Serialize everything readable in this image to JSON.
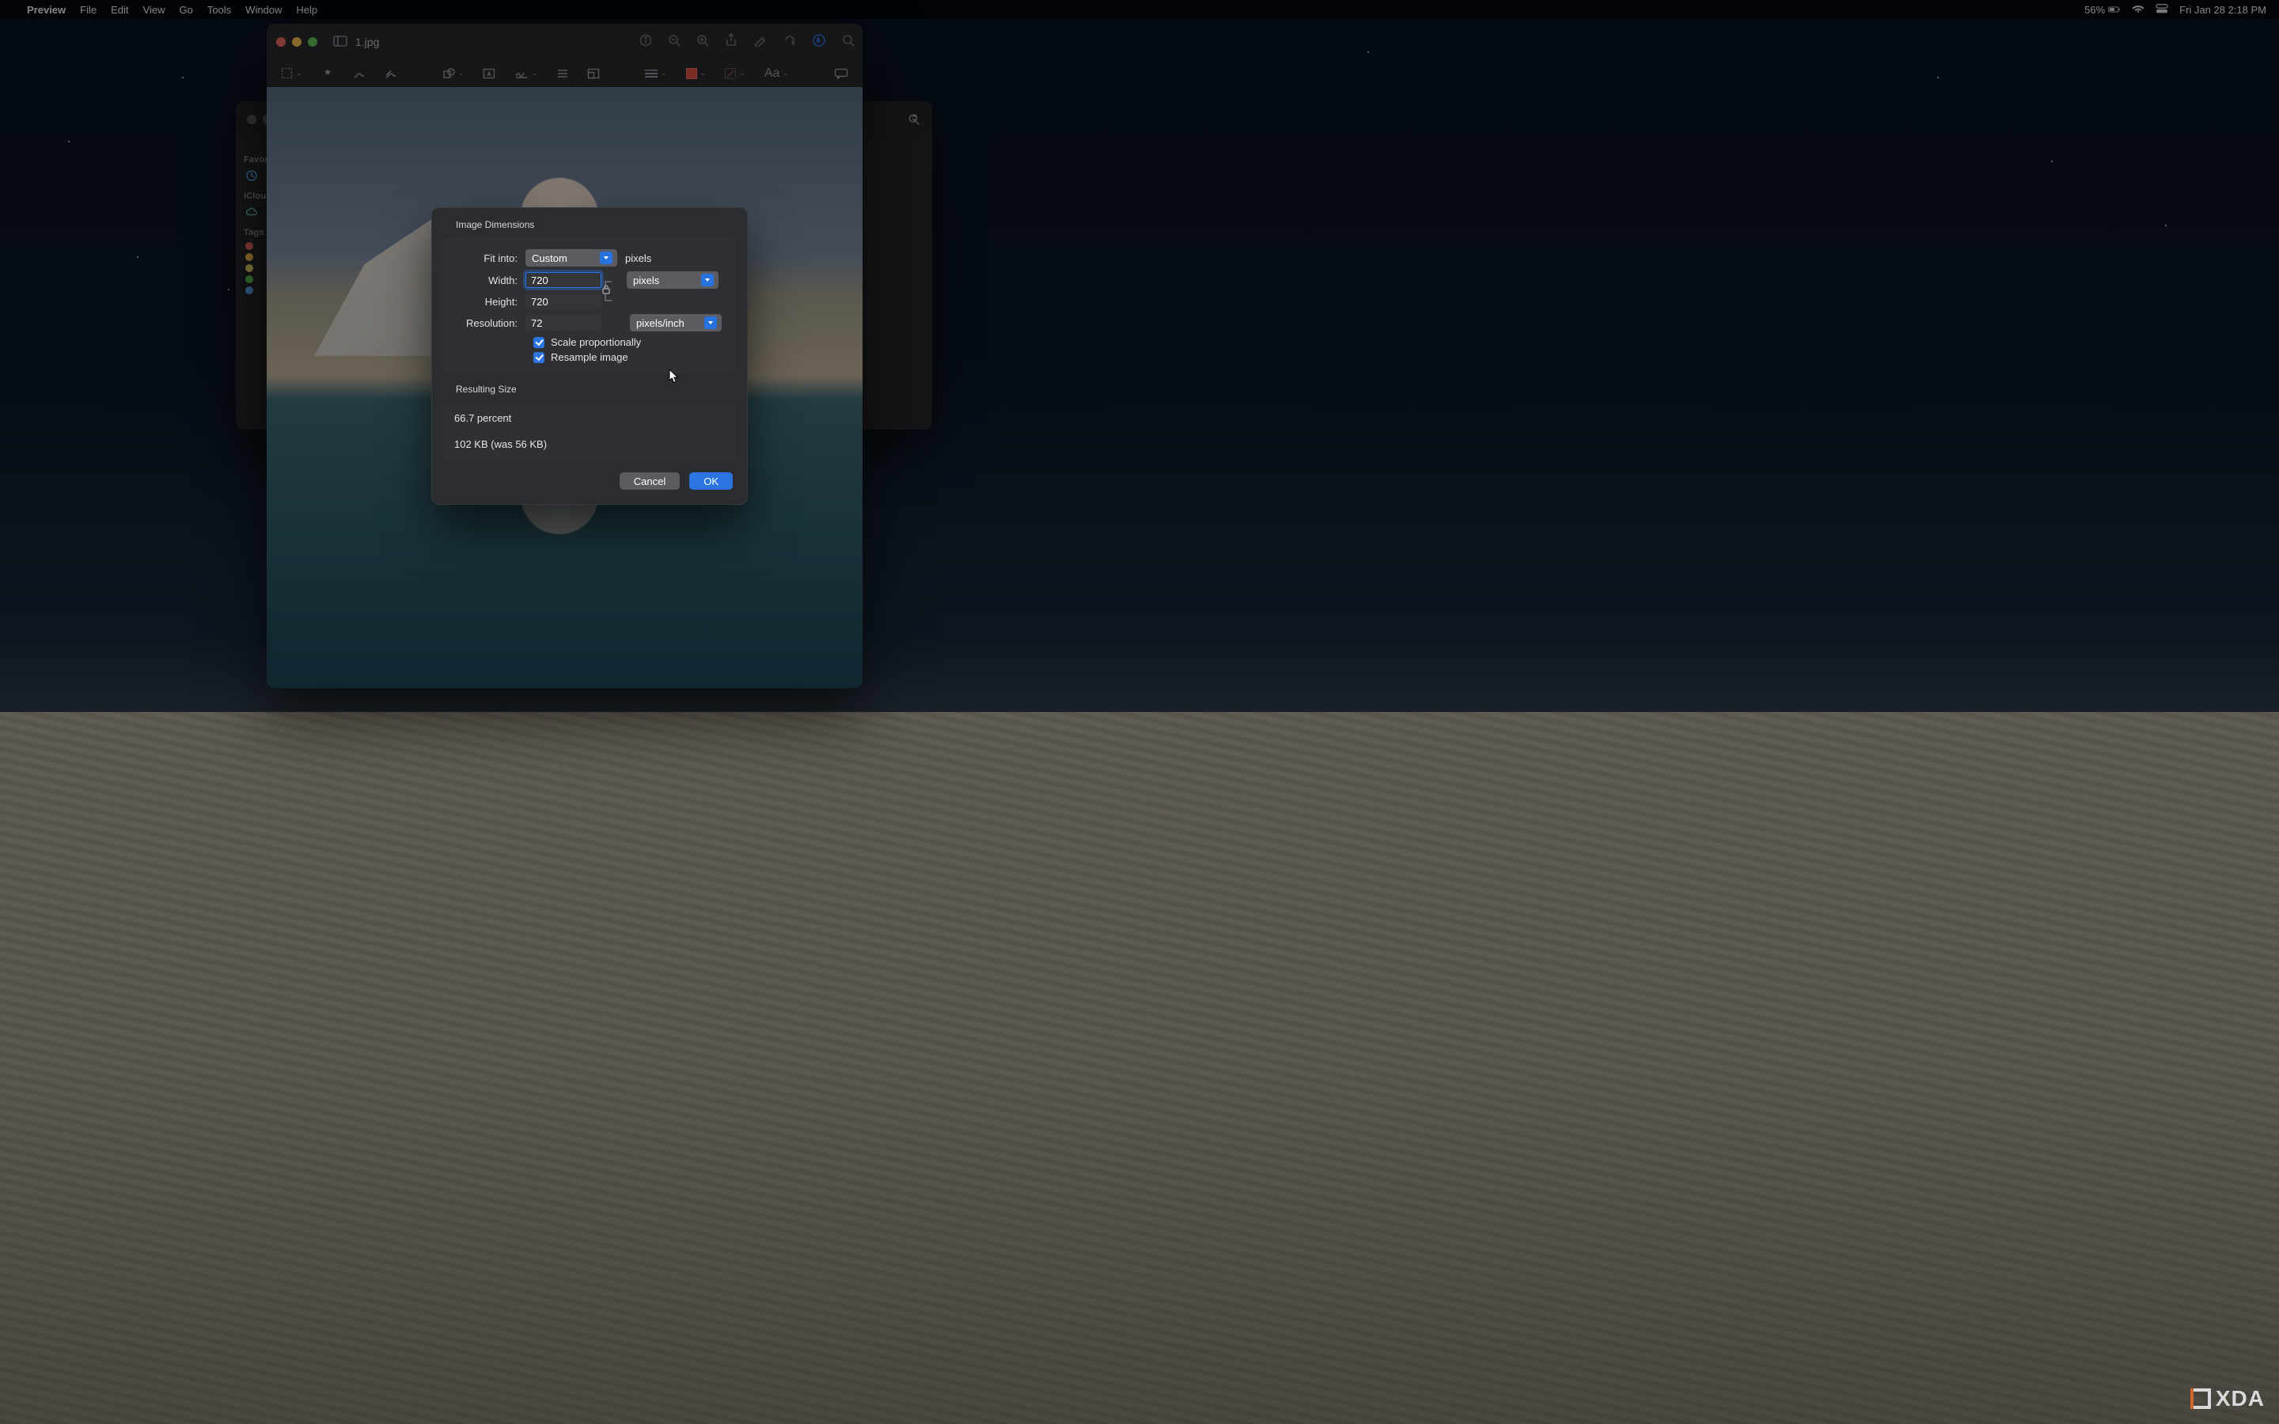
{
  "menubar": {
    "app": "Preview",
    "items": [
      "File",
      "Edit",
      "View",
      "Go",
      "Tools",
      "Window",
      "Help"
    ],
    "battery": "56%",
    "datetime": "Fri Jan 28  2:18 PM"
  },
  "finder": {
    "sidebar": {
      "favorites_label": "Favorites",
      "icloud_label": "iCloud",
      "tags_label": "Tags"
    }
  },
  "preview": {
    "filename": "1.jpg",
    "toolbar2": {
      "text_label": "Aa"
    }
  },
  "dialog": {
    "section1": "Image Dimensions",
    "fit_label": "Fit into:",
    "fit_value": "Custom",
    "fit_suffix": "pixels",
    "width_label": "Width:",
    "width_value": "720",
    "height_label": "Height:",
    "height_value": "720",
    "units_value": "pixels",
    "res_label": "Resolution:",
    "res_value": "72",
    "res_units": "pixels/inch",
    "scale_label": "Scale proportionally",
    "resample_label": "Resample image",
    "section2": "Resulting Size",
    "percent_text": "66.7 percent",
    "size_text": "102 KB (was 56 KB)",
    "cancel": "Cancel",
    "ok": "OK"
  },
  "watermark": "XDA"
}
